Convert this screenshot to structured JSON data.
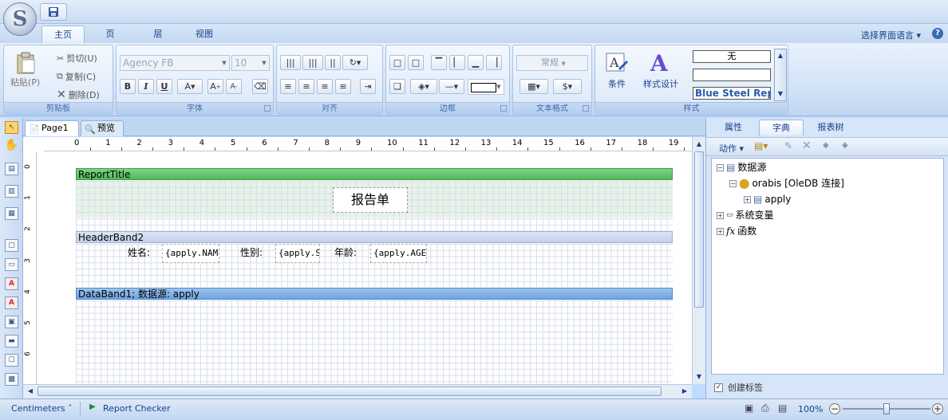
{
  "app": {
    "orb_glyph": "S"
  },
  "tabs": [
    {
      "label": "主页",
      "active": true
    },
    {
      "label": "页",
      "active": false
    },
    {
      "label": "层",
      "active": false
    },
    {
      "label": "视图",
      "active": false
    }
  ],
  "header": {
    "language_selector": "选择界面语言 ▾",
    "help": "?"
  },
  "ribbon": {
    "clipboard": {
      "label": "剪贴板",
      "paste": "粘贴(P)",
      "cut": "剪切(U)",
      "copy": "复制(C)",
      "delete": "删除(D)"
    },
    "font": {
      "label": "字体",
      "font_name": "Agency FB",
      "font_size": "10",
      "bold": "B",
      "italic": "I",
      "underline": "U",
      "font_color": "A",
      "grow": "A",
      "shrink": "A"
    },
    "align": {
      "label": "对齐"
    },
    "border": {
      "label": "边框"
    },
    "text_format": {
      "label": "文本格式",
      "format_value": "常规"
    },
    "styles": {
      "label": "样式",
      "condition": "条件",
      "style_design": "样式设计",
      "style_list": [
        "无",
        "",
        "Blue Steel Rep"
      ]
    }
  },
  "doc_tabs": [
    {
      "label": "Page1",
      "active": true
    },
    {
      "label": "预览",
      "active": false
    }
  ],
  "ruler": {
    "h_ticks": [
      "0",
      "1",
      "2",
      "3",
      "4",
      "5",
      "6",
      "7",
      "8",
      "9",
      "10",
      "11",
      "12",
      "13",
      "14",
      "15",
      "16",
      "17",
      "18",
      "19"
    ],
    "v_ticks": [
      "0",
      "1",
      "2",
      "3",
      "4",
      "5",
      "6"
    ]
  },
  "report": {
    "title_band": "ReportTitle",
    "title_text": "报告单",
    "header_band": "HeaderBand2",
    "header_fields": [
      {
        "label": "姓名:",
        "field": "{apply.NAM"
      },
      {
        "label": "性别:",
        "field": "{apply.S"
      },
      {
        "label": "年龄:",
        "field": "{apply.AGE"
      }
    ],
    "data_band": "DataBand1; 数据源: apply"
  },
  "right_panel": {
    "tabs": [
      {
        "label": "属性",
        "active": false
      },
      {
        "label": "字典",
        "active": true
      },
      {
        "label": "报表树",
        "active": false
      }
    ],
    "toolbar_action": "动作 ▾",
    "tree": [
      {
        "label": "数据源",
        "level": 0,
        "expander": "⊟"
      },
      {
        "label": "orabis [OleDB 连接]",
        "level": 1,
        "expander": "⊟"
      },
      {
        "label": "apply",
        "level": 2,
        "expander": "⊞"
      },
      {
        "label": "系统变量",
        "level": 0,
        "expander": "⊞"
      },
      {
        "label": "函数",
        "level": 0,
        "expander": "⊞"
      }
    ],
    "create_label_checkbox": "创建标签",
    "create_label_checked": true
  },
  "status": {
    "units": "Centimeters ˆ",
    "report_checker": "Report Checker",
    "zoom": "100%",
    "zoom_level": 1.0
  },
  "colors": {
    "title_band": "#5cc36a",
    "header_band": "#c9d4ee",
    "data_band": "#7eaee6"
  }
}
